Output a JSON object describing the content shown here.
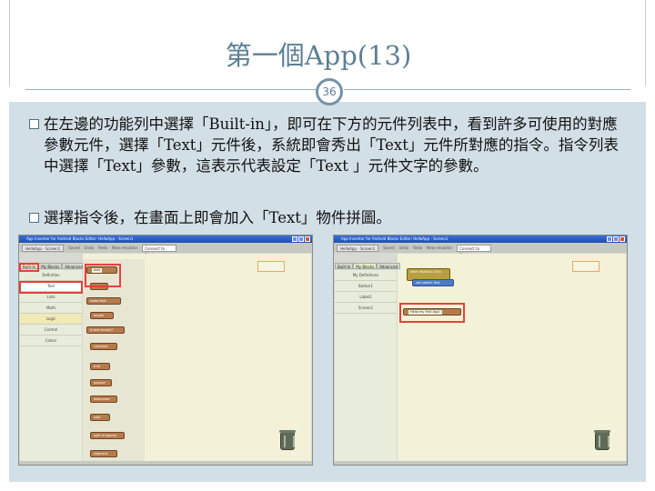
{
  "slide": {
    "title": "第一個App(13)",
    "page_number": "36",
    "bullets": [
      "在左邊的功能列中選擇「Built-in」，即可在下方的元件列表中，看到許多可使用的對應參數元件，選擇「Text」元件後，系統即會秀出「Text」元件所對應的指令。指令列表中選擇「Text」參數，這表示代表設定「Text 」元件文字的參數。",
      "選擇指令後，在畫面上即會加入「Text」物件拼圖。"
    ]
  },
  "screenshot_left": {
    "window_title": "App Inventor for Android Blocks Editor: HelloApp - Screen1",
    "toolbar": {
      "project": "HelloApp - Screen1",
      "items": [
        "Saved",
        "Undo",
        "Redo",
        "New emulator"
      ],
      "device": "Connect to Device..."
    },
    "tabs": [
      "Built-In",
      "My Blocks",
      "Advanced"
    ],
    "drawers": [
      "Definition",
      "Text",
      "Lists",
      "Math",
      "Logic",
      "Control",
      "Colors"
    ],
    "blocks": [
      "text",
      "join",
      "make text",
      "length",
      "is text empty?",
      "compare",
      "trim",
      "upcase",
      "downcase",
      "split",
      "split at spaces",
      "segment"
    ]
  },
  "screenshot_right": {
    "window_title": "App Inventor for Android Blocks Editor: HelloApp - Screen1",
    "toolbar": {
      "project": "HelloApp - Screen1",
      "items": [
        "Saved",
        "Undo",
        "Redo",
        "New emulator"
      ],
      "device": "Connect to Device..."
    },
    "tabs": [
      "Built-In",
      "My Blocks",
      "Advanced"
    ],
    "drawers": [
      "My Definitions",
      "Button1",
      "Label1",
      "Screen1"
    ],
    "blocks": {
      "event": "when Button1.Click",
      "setter": "set Label1.Text",
      "text_block": "Hello my first App!"
    }
  },
  "colors": {
    "title": "#5d7f96",
    "panel": "#d3dfe6",
    "highlight": "#e8403a"
  }
}
